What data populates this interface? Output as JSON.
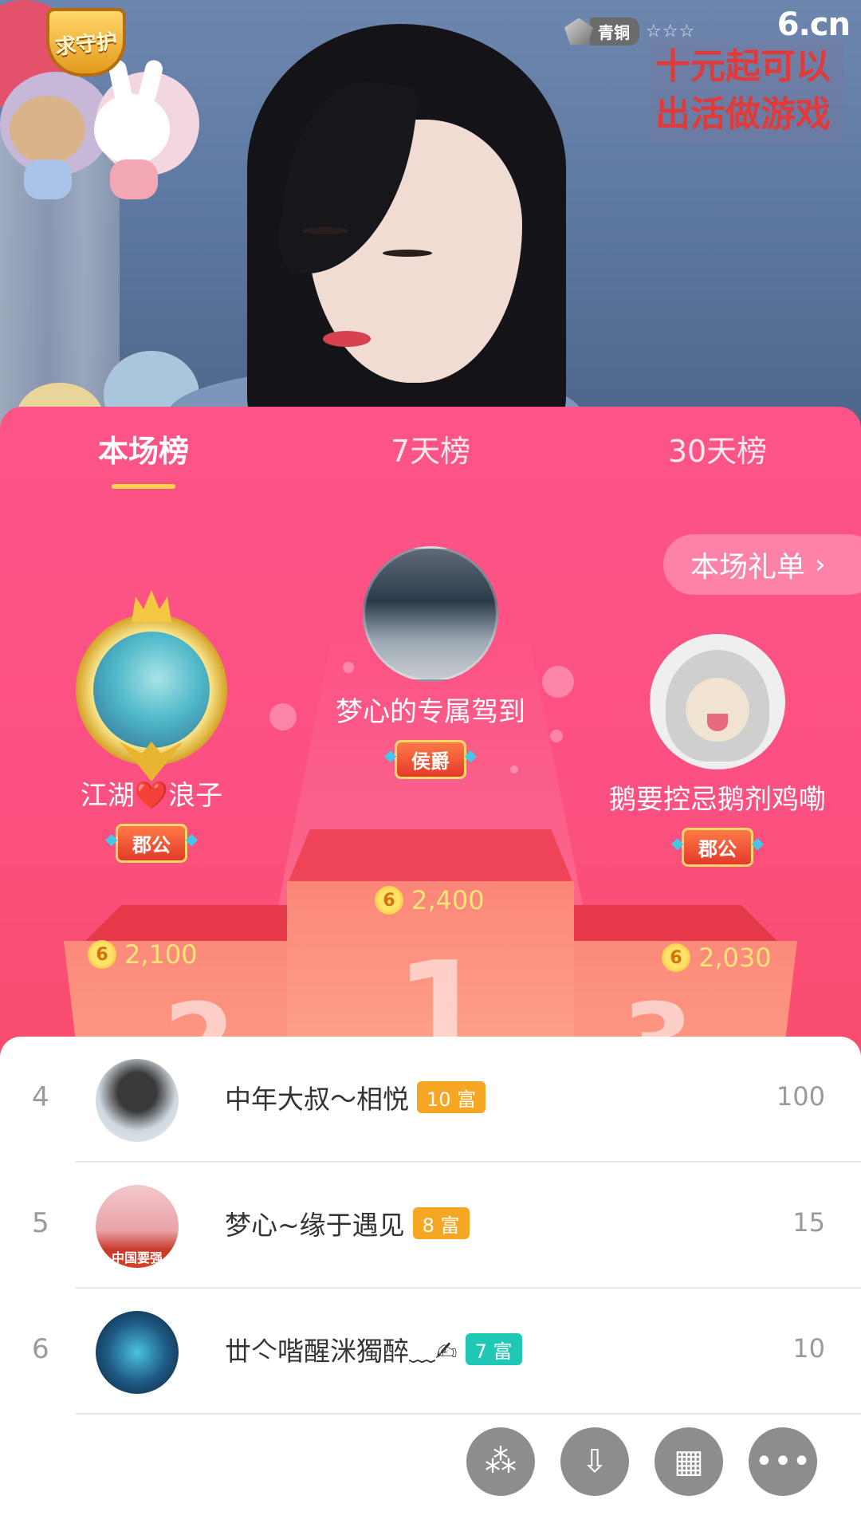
{
  "stream": {
    "guard_badge": "求守护",
    "rank_label": "青铜",
    "rank_stars": "☆☆☆",
    "site_logo": "6.cn",
    "promo": [
      "十元起可以",
      "出活做游戏"
    ]
  },
  "tabs": [
    {
      "label": "本场榜",
      "active": true
    },
    {
      "label": "7天榜",
      "active": false
    },
    {
      "label": "30天榜",
      "active": false
    }
  ],
  "gift_list_button": {
    "label": "本场礼单",
    "icon": "chevron-right-icon"
  },
  "top3": {
    "first": {
      "rank": "1",
      "name": "梦心的专属驾到",
      "title": "侯爵",
      "score": "2,400"
    },
    "second": {
      "rank": "2",
      "name": "江湖❤️浪子",
      "title": "郡公",
      "score": "2,100"
    },
    "third": {
      "rank": "3",
      "name": "鹅要控忌鹅剂鸡嘞",
      "title": "郡公",
      "score": "2,030"
    }
  },
  "coin_symbol": "6",
  "list": [
    {
      "rank": "4",
      "name": "中年大叔～相悦",
      "level": "10 富",
      "level_color": "#f5a623",
      "score": "100"
    },
    {
      "rank": "5",
      "name": "梦心~缘于遇见",
      "level": "8 富",
      "level_color": "#f5a623",
      "score": "15",
      "avatar_text": "中国要强"
    },
    {
      "rank": "6",
      "name": "丗亽喈醒洣獨醉﹏✍",
      "level": "7 富",
      "level_color": "#1ec8b4",
      "score": "10"
    }
  ],
  "toolbar": [
    {
      "name": "share-icon",
      "glyph": "⁂"
    },
    {
      "name": "download-icon",
      "glyph": "⇩"
    },
    {
      "name": "apps-grid-icon",
      "glyph": "▦"
    },
    {
      "name": "more-icon",
      "glyph": "•••"
    }
  ]
}
